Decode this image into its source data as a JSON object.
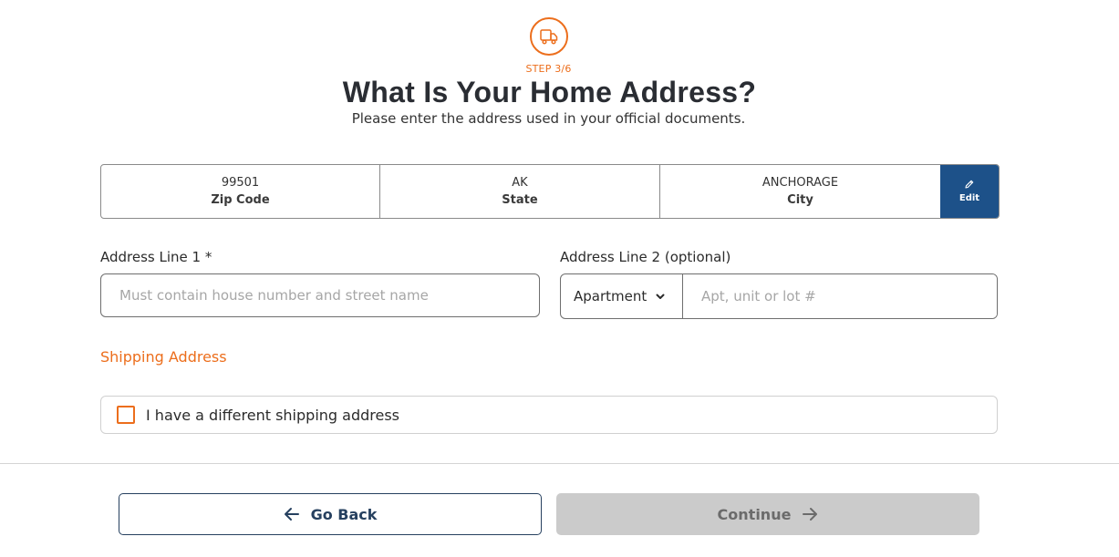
{
  "header": {
    "step_icon": "delivery-truck-icon",
    "step_label": "STEP 3/6",
    "title": "What Is Your Home Address?",
    "subtitle": "Please enter the address used in your official documents."
  },
  "summary": {
    "zip": {
      "value": "99501",
      "label": "Zip Code"
    },
    "state": {
      "value": "AK",
      "label": "State"
    },
    "city": {
      "value": "ANCHORAGE",
      "label": "City"
    },
    "edit_label": "Edit",
    "edit_icon": "pencil-icon"
  },
  "form": {
    "address1": {
      "label": "Address Line 1 *",
      "value": "",
      "placeholder": "Must contain house number and street name"
    },
    "address2": {
      "label": "Address Line 2 (optional)",
      "unit_type_selected": "Apartment",
      "value": "",
      "placeholder": "Apt, unit or lot #"
    }
  },
  "shipping": {
    "heading": "Shipping Address",
    "checkbox_label": "I have a different shipping address",
    "checked": false
  },
  "footer": {
    "back_label": "Go Back",
    "continue_label": "Continue",
    "continue_disabled": true
  },
  "colors": {
    "accent_orange": "#ec6e1c",
    "primary_blue": "#1d5189",
    "back_button_navy": "#26405f",
    "disabled_gray": "#cbcbcb"
  }
}
